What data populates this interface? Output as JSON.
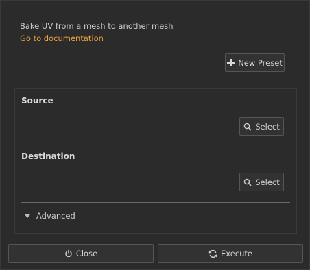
{
  "header": {
    "description": "Bake UV from a mesh to another mesh",
    "doc_link": "Go to documentation"
  },
  "toolbar": {
    "new_preset_label": "New Preset",
    "new_preset_icon": "plus-icon"
  },
  "source": {
    "title": "Source",
    "select_label": "Select",
    "select_icon": "search-icon"
  },
  "destination": {
    "title": "Destination",
    "select_label": "Select",
    "select_icon": "search-icon"
  },
  "advanced": {
    "label": "Advanced",
    "icon": "caret-down-icon"
  },
  "footer": {
    "close_label": "Close",
    "close_icon": "power-icon",
    "execute_label": "Execute",
    "execute_icon": "refresh-icon"
  },
  "colors": {
    "background": "#2b2b2b",
    "link": "#e8a33c",
    "button_bg": "#323232",
    "button_border": "#555555"
  }
}
